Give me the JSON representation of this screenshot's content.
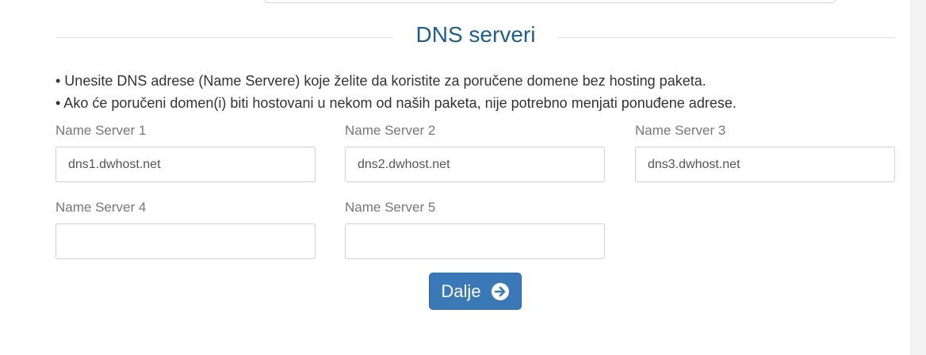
{
  "section": {
    "title": "DNS serveri"
  },
  "notes": [
    "• Unesite DNS adrese (Name Servere) koje želite da koristite za poručene domene bez hosting paketa.",
    "• Ako će poručeni domen(i) biti hostovani u nekom od naših paketa, nije potrebno menjati ponuđene adrese."
  ],
  "fields": [
    {
      "label": "Name Server 1",
      "value": "dns1.dwhost.net"
    },
    {
      "label": "Name Server 2",
      "value": "dns2.dwhost.net"
    },
    {
      "label": "Name Server 3",
      "value": "dns3.dwhost.net"
    },
    {
      "label": "Name Server 4",
      "value": ""
    },
    {
      "label": "Name Server 5",
      "value": ""
    }
  ],
  "submit": {
    "label": "Dalje",
    "icon": "arrow-circle-right-icon"
  },
  "colors": {
    "title": "#1f5e8c",
    "button": "#3a78b8"
  }
}
